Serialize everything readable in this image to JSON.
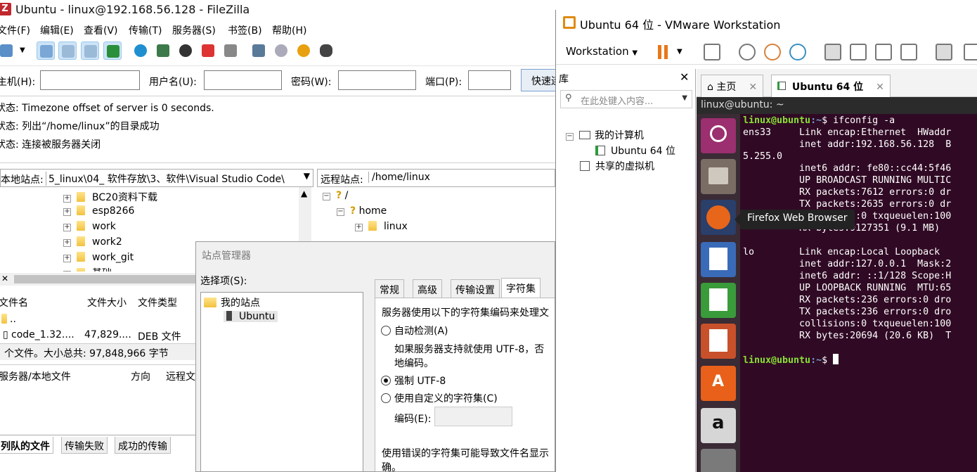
{
  "filezilla": {
    "title": "Ubuntu - linux@192.168.56.128 - FileZilla",
    "menu": [
      "文件(F)",
      "编辑(E)",
      "查看(V)",
      "传输(T)",
      "服务器(S)",
      "书签(B)",
      "帮助(H)"
    ],
    "quickconnect": {
      "host_label": "主机(H):",
      "user_label": "用户名(U):",
      "pass_label": "密码(W):",
      "port_label": "端口(P):",
      "button": "快速连"
    },
    "log": [
      {
        "prefix": "状态:",
        "text": "Timezone offset of server is 0 seconds."
      },
      {
        "prefix": "状态:",
        "text": "列出“/home/linux”的目录成功"
      },
      {
        "prefix": "状态:",
        "text": "连接被服务器关闭"
      }
    ],
    "local_site": {
      "label": "本地站点:",
      "path": "5_linux\\04_ 软件存放\\3、软件\\Visual Studio Code\\"
    },
    "remote_site": {
      "label": "远程站点:",
      "path": "/home/linux"
    },
    "local_tree": [
      "BC20资料下载",
      "esp8266",
      "work",
      "work2",
      "work_git",
      "基础"
    ],
    "remote_tree": [
      "/",
      "home",
      "linux"
    ],
    "local_files": {
      "headers": [
        "文件名",
        "文件大小",
        "文件类型"
      ],
      "rows": [
        {
          "name": "..",
          "size": "",
          "type": ""
        },
        {
          "name": "code_1.32....",
          "size": "47,829....",
          "type": "DEB 文件"
        }
      ],
      "status": "个文件。大小总共: 97,848,966 字节"
    },
    "queue_headers": [
      "服务器/本地文件",
      "方向",
      "远程文"
    ],
    "queue_tabs": [
      "列队的文件",
      "传输失败",
      "成功的传输"
    ]
  },
  "site_manager": {
    "title": "站点管理器",
    "select_label": "选择项(S):",
    "tree": {
      "root": "我的站点",
      "site": "Ubuntu"
    },
    "tabs": [
      "常规",
      "高级",
      "传输设置",
      "字符集"
    ],
    "panel": {
      "intro": "服务器使用以下的字符集编码来处理文",
      "opt_auto": "自动检测(A)",
      "auto_hint1": "如果服务器支持就使用 UTF-8，否",
      "auto_hint2": "地编码。",
      "opt_utf8": "强制 UTF-8",
      "opt_custom": "使用自定义的字符集(C)",
      "encoding_label": "编码(E):",
      "warn1": "使用错误的字符集可能导致文件名显示",
      "warn2": "确。"
    }
  },
  "vmware": {
    "title": "Ubuntu 64 位 - VMware Workstation",
    "workstation_menu": "Workstation",
    "library": {
      "header": "库",
      "search_placeholder": "在此处键入内容...",
      "my_computer": "我的计算机",
      "vm_name": "Ubuntu 64 位",
      "shared": "共享的虚拟机"
    },
    "tabs": [
      "主页",
      "Ubuntu 64 位"
    ],
    "guest": {
      "top_title": "linux@ubuntu: ~",
      "tooltip": "Firefox Web Browser",
      "terminal": {
        "prompt_user": "linux@ubuntu",
        "prompt_path": ":~",
        "command": "$ ifconfig -a",
        "lines": [
          "ens33     Link encap:Ethernet  HWaddr",
          "          inet addr:192.168.56.128  B",
          "5.255.0",
          "          inet6 addr: fe80::cc44:5f46",
          "          UP BROADCAST RUNNING MULTIC",
          "          RX packets:7612 errors:0 dr",
          "          TX packets:2635 errors:0 dr",
          "          collisions:0 txqueuelen:100",
          "          RX bytes:9127351 (9.1 MB)",
          "",
          "lo        Link encap:Local Loopback",
          "          inet addr:127.0.0.1  Mask:2",
          "          inet6 addr: ::1/128 Scope:H",
          "          UP LOOPBACK RUNNING  MTU:65",
          "          RX packets:236 errors:0 dro",
          "          TX packets:236 errors:0 dro",
          "          collisions:0 txqueuelen:100",
          "          RX bytes:20694 (20.6 KB)  T",
          ""
        ],
        "final_prompt": "$ "
      }
    }
  }
}
